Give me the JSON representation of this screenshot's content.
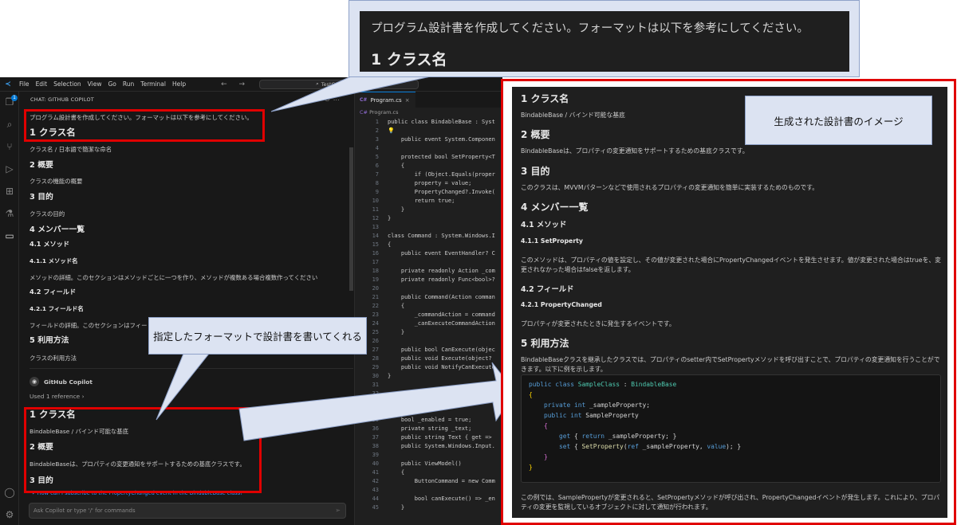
{
  "zoom_top": {
    "prompt": "プログラム設計書を作成してください。フォーマットは以下を参考にしてください。",
    "heading": "1 クラス名"
  },
  "titlebar": {
    "menu": [
      "File",
      "Edit",
      "Selection",
      "View",
      "Go",
      "Run",
      "Terminal",
      "Help"
    ],
    "nav_arrows": "← →",
    "search_text": "TestConsoleApp"
  },
  "activitybar": {
    "badge": "1"
  },
  "chat": {
    "header": "CHAT: GITHUB COPILOT",
    "prompt": "プログラム設計書を作成してください。フォーマットは以下を参考にしてください。",
    "s1_title": "1 クラス名",
    "s1_text": "クラス名 / 日本語で簡潔な命名",
    "s2_title": "2 概要",
    "s2_text": "クラスの機能の概要",
    "s3_title": "3 目的",
    "s3_text": "クラスの目的",
    "s4_title": "4 メンバー一覧",
    "s41_title": "4.1 メソッド",
    "s411_title": "4.1.1 メソッド名",
    "s411_text": "メソッドの詳細。このセクションはメソッドごとに一つを作り、メソッドが複数ある場合複数作ってください",
    "s42_title": "4.2 フィールド",
    "s421_title": "4.2.1 フィールド名",
    "s421_text": "フィールドの詳細。このセクションはフィー",
    "s5_title": "5 利用方法",
    "s5_text": "クラスの利用方法",
    "copilot_name": "GitHub Copilot",
    "used_refs": "Used 1 reference",
    "r1_title": "1 クラス名",
    "r1_text": "BindableBase / バインド可能な基底",
    "r2_title": "2 概要",
    "r2_text": "BindableBaseは、プロパティの変更通知をサポートするための基底クラスです。",
    "r3_title": "3 目的",
    "suggestion": "How can I subscribe to the PropertyChanged event in the BindableBase class?",
    "input_placeholder": "Ask Copilot or type '/' for commands"
  },
  "editor": {
    "tab_label": "Program.cs",
    "tab_ext": "C#",
    "breadcrumb": "Program.cs",
    "lines": [
      {
        "n": "1",
        "t": "public class BindableBase : Syst"
      },
      {
        "n": "2",
        "t": "💡"
      },
      {
        "n": "3",
        "t": "    public event System.Componen"
      },
      {
        "n": "4",
        "t": ""
      },
      {
        "n": "5",
        "t": "    protected bool SetProperty<T"
      },
      {
        "n": "6",
        "t": "    {"
      },
      {
        "n": "7",
        "t": "        if (Object.Equals(proper"
      },
      {
        "n": "8",
        "t": "        property = value;"
      },
      {
        "n": "9",
        "t": "        PropertyChanged?.Invoke("
      },
      {
        "n": "10",
        "t": "        return true;"
      },
      {
        "n": "11",
        "t": "    }"
      },
      {
        "n": "12",
        "t": "}"
      },
      {
        "n": "13",
        "t": ""
      },
      {
        "n": "14",
        "t": "class Command : System.Windows.I"
      },
      {
        "n": "15",
        "t": "{"
      },
      {
        "n": "16",
        "t": "    public event EventHandler? C"
      },
      {
        "n": "17",
        "t": ""
      },
      {
        "n": "18",
        "t": "    private readonly Action _com"
      },
      {
        "n": "19",
        "t": "    private readonly Func<bool>?"
      },
      {
        "n": "20",
        "t": ""
      },
      {
        "n": "21",
        "t": "    public Command(Action comman"
      },
      {
        "n": "22",
        "t": "    {"
      },
      {
        "n": "23",
        "t": "        _commandAction = command"
      },
      {
        "n": "24",
        "t": "        _canExecuteCommandAction"
      },
      {
        "n": "25",
        "t": "    }"
      },
      {
        "n": "26",
        "t": ""
      },
      {
        "n": "27",
        "t": "    public bool CanExecute(objec"
      },
      {
        "n": "28",
        "t": "    public void Execute(object? "
      },
      {
        "n": "29",
        "t": "    public void NotifyCanExecute"
      },
      {
        "n": "30",
        "t": "}"
      },
      {
        "n": "31",
        "t": ""
      },
      {
        "n": "32",
        "t": ""
      },
      {
        "n": "33",
        "t": ""
      },
      {
        "n": "34",
        "t": ""
      },
      {
        "n": "35",
        "t": "    bool _enabled = true;"
      },
      {
        "n": "36",
        "t": "    private string _text;"
      },
      {
        "n": "37",
        "t": "    public string Text { get =>"
      },
      {
        "n": "38",
        "t": "    public System.Windows.Input."
      },
      {
        "n": "39",
        "t": ""
      },
      {
        "n": "40",
        "t": "    public ViewModel()"
      },
      {
        "n": "41",
        "t": "    {"
      },
      {
        "n": "42",
        "t": "        ButtonCommand = new Comm"
      },
      {
        "n": "43",
        "t": ""
      },
      {
        "n": "44",
        "t": "        bool canExecute() => _en"
      },
      {
        "n": "45",
        "t": "    }"
      }
    ]
  },
  "callouts": {
    "generated_doc": "生成された設計書のイメージ",
    "writes_doc": "指定したフォーマットで設計書を書いてくれる"
  },
  "big": {
    "h1": "1 クラス名",
    "p1": "BindableBase / バインド可能な基底",
    "h2": "2 概要",
    "p2": "BindableBaseは、プロパティの変更通知をサポートするための基底クラスです。",
    "h3": "3 目的",
    "p3": "このクラスは、MVVMパターンなどで使用されるプロパティの変更通知を簡単に実装するためのものです。",
    "h4": "4 メンバー一覧",
    "h41": "4.1 メソッド",
    "h411": "4.1.1 SetProperty",
    "p411": "このメソッドは、プロパティの値を設定し、その値が変更された場合にPropertyChangedイベントを発生させます。値が変更された場合はtrueを、変更されなかった場合はfalseを返します。",
    "h42": "4.2 フィールド",
    "h421": "4.2.1 PropertyChanged",
    "p421": "プロパティが変更されたときに発生するイベントです。",
    "h5": "5 利用方法",
    "p5": "BindableBaseクラスを継承したクラスでは、プロパティのsetter内でSetPropertyメソッドを呼び出すことで、プロパティの変更通知を行うことができます。以下に例を示します。",
    "code": [
      "public class SampleClass : BindableBase",
      "{",
      "    private int _sampleProperty;",
      "    public int SampleProperty",
      "    {",
      "        get { return _sampleProperty; }",
      "        set { SetProperty(ref _sampleProperty, value); }",
      "    }",
      "}"
    ],
    "p_end": "この例では、SamplePropertyが変更されると、SetPropertyメソッドが呼び出され、PropertyChangedイベントが発生します。これにより、プロパティの変更を監視しているオブジェクトに対して通知が行われます。"
  },
  "colors": {
    "highlight_border": "#e00000",
    "callout_fill": "#dce3f2",
    "editor_bg": "#1f1f1f",
    "accent": "#0078d4"
  }
}
